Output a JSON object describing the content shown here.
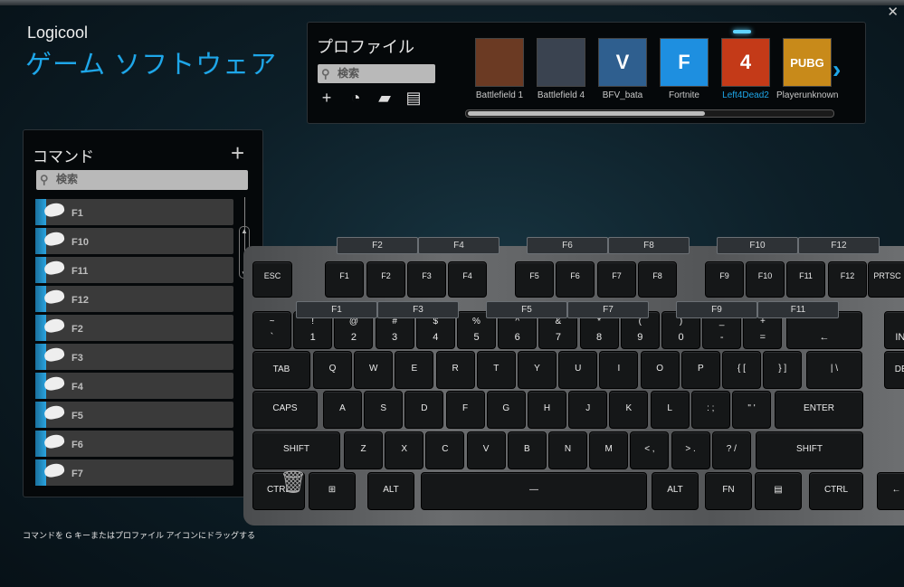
{
  "window": {
    "close_label": "✕"
  },
  "header": {
    "brand": "Logicool",
    "title": "ゲーム ソフトウェア"
  },
  "profiles": {
    "title": "プロファイル",
    "search_placeholder": "検索",
    "tools": [
      {
        "icon": "plus-icon",
        "glyph": "+"
      },
      {
        "icon": "clock-icon",
        "glyph": "◔"
      },
      {
        "icon": "folder-icon",
        "glyph": "▰"
      },
      {
        "icon": "printer-icon",
        "glyph": "▤"
      }
    ],
    "games": [
      {
        "name": "Battlefield 1",
        "color": "#6b3a23",
        "glyph": "",
        "active": false
      },
      {
        "name": "Battlefield 4",
        "color": "#3a4350",
        "glyph": "",
        "active": false
      },
      {
        "name": "BFV_bata",
        "color": "#2f5f8f",
        "glyph": "V",
        "active": false
      },
      {
        "name": "Fortnite",
        "color": "#1e8fe0",
        "glyph": "F",
        "active": false
      },
      {
        "name": "Left4Dead2",
        "color": "#c43a18",
        "glyph": "4",
        "active": true
      },
      {
        "name": "Playerunknown",
        "color": "#c88a1a",
        "glyph": "PUBG",
        "active": false
      }
    ]
  },
  "commands": {
    "title": "コマンド",
    "add_label": "+",
    "search_placeholder": "検索",
    "items": [
      "F1",
      "F10",
      "F11",
      "F12",
      "F2",
      "F3",
      "F4",
      "F5",
      "F6",
      "F7"
    ],
    "hint": "コマンドを G キーまたはプロファイル アイコンにドラッグする"
  },
  "keyboard": {
    "assigned_labels": [
      "F2",
      "F4",
      "F6",
      "F8",
      "F10",
      "F12",
      "F1",
      "F3",
      "F5",
      "F7",
      "F9",
      "F11"
    ],
    "frow": [
      "ESC",
      "F1",
      "F2",
      "F3",
      "F4",
      "F5",
      "F6",
      "F7",
      "F8",
      "F9",
      "F10",
      "F11",
      "F12",
      "PRTSC"
    ],
    "numrow": [
      [
        "~",
        "`"
      ],
      [
        "!",
        "1"
      ],
      [
        "@",
        "2"
      ],
      [
        "#",
        "3"
      ],
      [
        "$",
        "4"
      ],
      [
        "%",
        "5"
      ],
      [
        "^",
        "6"
      ],
      [
        "&",
        "7"
      ],
      [
        "*",
        "8"
      ],
      [
        "(",
        "9"
      ],
      [
        ")",
        "0"
      ],
      [
        "_",
        "-"
      ],
      [
        "+",
        "="
      ],
      [
        "",
        "←"
      ],
      [
        "",
        "INS"
      ]
    ],
    "qrow": [
      "TAB",
      "Q",
      "W",
      "E",
      "R",
      "T",
      "Y",
      "U",
      "I",
      "O",
      "P",
      "{ [",
      "} ]",
      "| \\",
      "DEL"
    ],
    "arow": [
      "CAPS",
      "A",
      "S",
      "D",
      "F",
      "G",
      "H",
      "J",
      "K",
      "L",
      ": ;",
      "\" '",
      "ENTER"
    ],
    "zrow": [
      "SHIFT",
      "Z",
      "X",
      "C",
      "V",
      "B",
      "N",
      "M",
      "< ,",
      "> .",
      "? /",
      "SHIFT"
    ],
    "brow": [
      "CTRL",
      "⊞",
      "ALT",
      "—",
      "ALT",
      "FN",
      "▤",
      "CTRL",
      "←"
    ]
  }
}
